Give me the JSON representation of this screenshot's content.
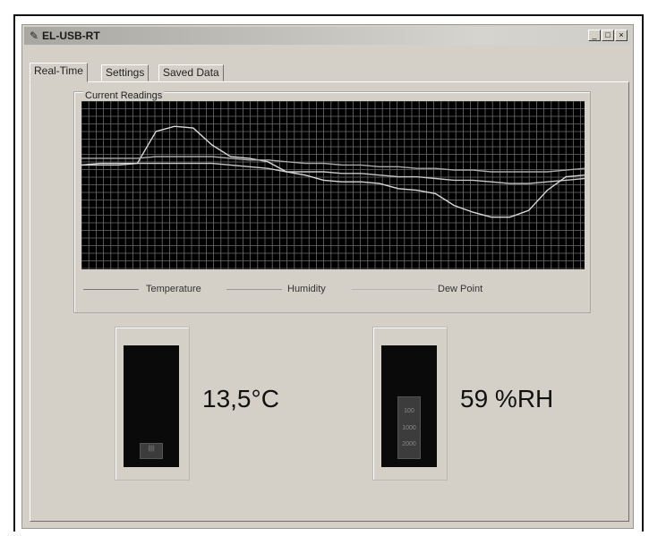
{
  "window": {
    "title": "EL-USB-RT",
    "app_icon": "device-icon",
    "buttons": {
      "minimize": "_",
      "maximize": "□",
      "close": "×"
    }
  },
  "tabs": [
    {
      "label": "Real-Time",
      "active": true
    },
    {
      "label": "Settings",
      "active": false
    },
    {
      "label": "Saved Data",
      "active": false
    }
  ],
  "current_readings": {
    "group_title": "Current Readings",
    "legend": {
      "temperature": "Temperature",
      "humidity": "Humidity",
      "dew_point": "Dew Point"
    }
  },
  "chart_data": {
    "type": "line",
    "grid": true,
    "series": [
      {
        "name": "Temperature",
        "color": "#c8c8c8",
        "values": [
          62,
          62,
          62,
          63,
          63,
          63,
          63,
          63,
          62,
          61,
          60,
          58,
          58,
          58,
          57,
          57,
          56,
          55,
          55,
          54,
          53,
          53,
          52,
          51,
          51,
          52,
          53,
          54
        ]
      },
      {
        "name": "Humidity",
        "color": "#d8d8d8",
        "values": [
          62,
          63,
          63,
          63,
          82,
          85,
          84,
          74,
          67,
          66,
          64,
          58,
          56,
          53,
          52,
          52,
          51,
          48,
          47,
          45,
          38,
          34,
          31,
          31,
          35,
          47,
          55,
          56
        ]
      },
      {
        "name": "Dew Point",
        "color": "#aaaaaa",
        "values": [
          66,
          66,
          66,
          66,
          67,
          67,
          67,
          67,
          66,
          65,
          65,
          64,
          63,
          63,
          62,
          62,
          61,
          61,
          60,
          60,
          59,
          59,
          58,
          58,
          58,
          58,
          59,
          60
        ]
      }
    ],
    "ylim": [
      0,
      100
    ]
  },
  "temperature": {
    "value_text": "13,5°C",
    "level": 0.15,
    "bar_label": "||||"
  },
  "humidity": {
    "value_text": "59 %RH",
    "level": 0.59,
    "bar_labels": [
      "100",
      "1000",
      "2000"
    ]
  }
}
